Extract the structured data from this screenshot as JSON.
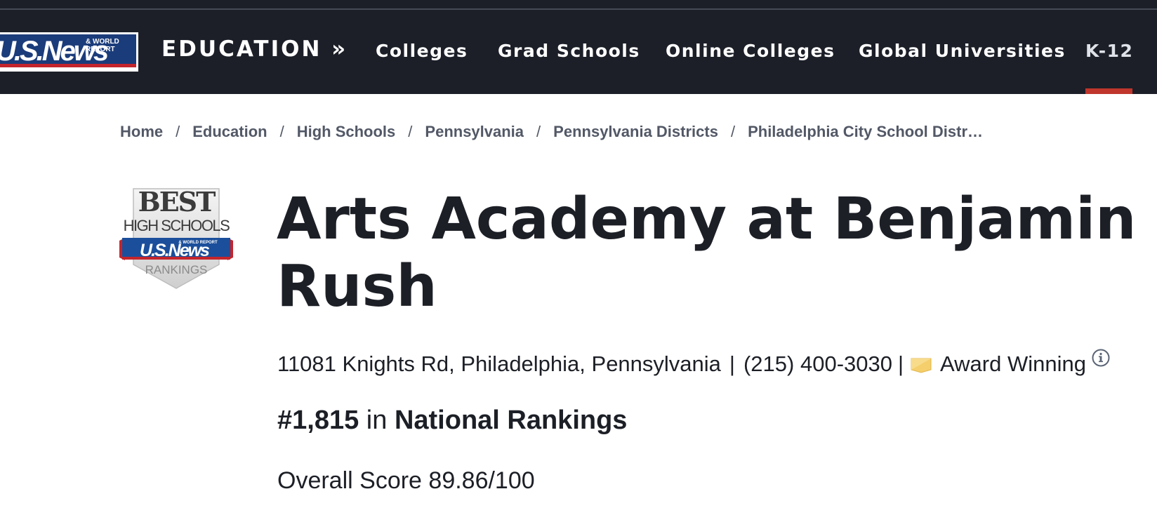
{
  "header": {
    "logo_text": "U.S.News",
    "logo_subtext": "& WORLD REPORT",
    "section_title": "EDUCATION »",
    "nav_links": [
      {
        "label": "Colleges"
      },
      {
        "label": "Grad Schools"
      },
      {
        "label": "Online Colleges"
      },
      {
        "label": "Global Universities"
      },
      {
        "label": "K-12"
      }
    ],
    "active_nav": "K-12",
    "active_color": "#c0362c",
    "background": "#1c1f28"
  },
  "breadcrumb": [
    "Home",
    "Education",
    "High Schools",
    "Pennsylvania",
    "Pennsylvania Districts",
    "Philadelphia City School Distr…"
  ],
  "breadcrumb_separator": "/",
  "badge": {
    "line1": "BEST",
    "line2": "HIGH SCHOOLS",
    "line3": "U.S.News",
    "line3_small": "& WORLD REPORT",
    "line4": "RANKINGS"
  },
  "school": {
    "name": "Arts Academy at Benjamin Rush",
    "address": "11081 Knights Rd, Philadelphia, Pennsylvania",
    "phone": "(215) 400-3030",
    "award": "Award Winning",
    "award_icon": "award-ribbon-icon",
    "rank_number": "#1,815",
    "rank_in": "in",
    "rank_list": "National Rankings",
    "overall_score": "Overall Score 89.86/100"
  }
}
